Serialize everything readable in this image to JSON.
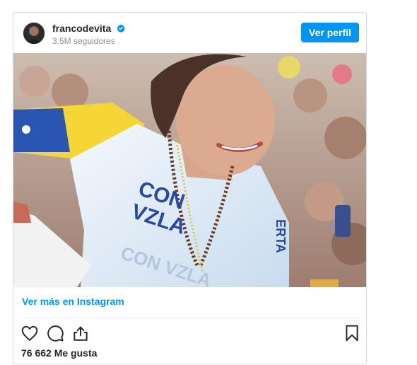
{
  "post": {
    "username": "francodevita",
    "followers": "3.5M seguidores",
    "profile_button": "Ver perfil",
    "view_more": "Ver más en Instagram",
    "likes": "76 662 Me gusta",
    "shirt_text_line1": "CON",
    "shirt_text_line2": "VZLA",
    "shirt_text_shadow": "CON VZLA",
    "sleeve_text": "ERTA"
  },
  "icons": [
    "verified-badge-icon",
    "heart-icon",
    "comment-icon",
    "share-icon",
    "bookmark-icon"
  ],
  "colors": {
    "accent": "#0095f6",
    "text": "#262626",
    "muted": "#8e8e8e",
    "border": "#dbdbdb"
  }
}
